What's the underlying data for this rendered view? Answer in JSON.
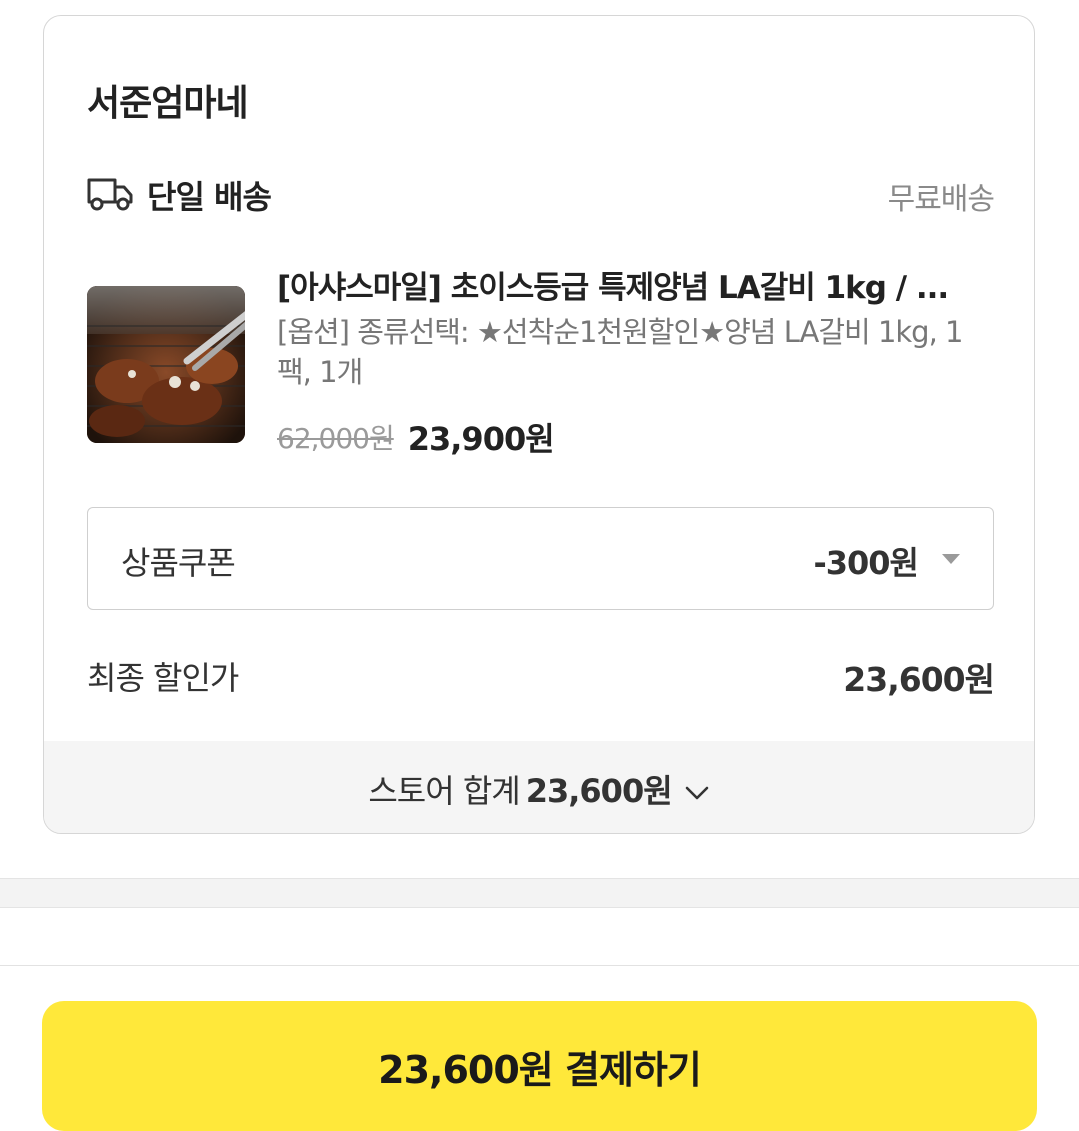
{
  "store": {
    "name": "서준엄마네",
    "delivery": {
      "icon": "truck-icon",
      "label": "단일 배송",
      "fee": "무료배송"
    },
    "product": {
      "title": "[아샤스마일] 초이스등급 특제양념 LA갈비 1kg / ...",
      "option": "[옵션] 종류선택: ★선착순1천원할인★양념 LA갈비 1kg, 1팩, 1개",
      "original_price": "62,000원",
      "sale_price": "23,900원"
    },
    "coupon": {
      "label": "상품쿠폰",
      "value": "-300원"
    },
    "final": {
      "label": "최종 할인가",
      "value": "23,600원"
    },
    "total": {
      "label": "스토어 합계",
      "value": "23,600원"
    }
  },
  "checkout": {
    "button_label": "23,600원 결제하기",
    "button_color": "#ffe83a"
  }
}
